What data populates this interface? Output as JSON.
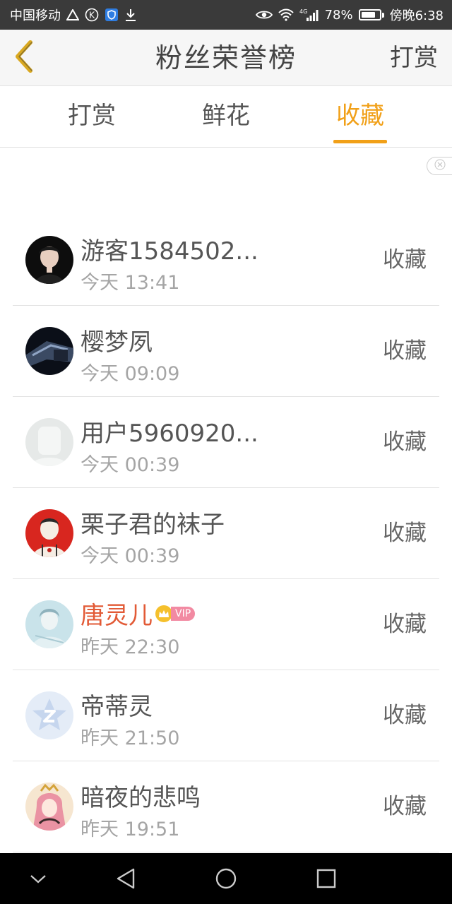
{
  "status_bar": {
    "carrier": "中国移动",
    "battery": "78%",
    "time": "傍晚6:38",
    "network": "4G",
    "icons": [
      "warning-icon",
      "k-icon",
      "shield-icon",
      "download-icon",
      "eye-icon",
      "wifi-icon",
      "signal-icon",
      "battery-icon"
    ]
  },
  "header": {
    "title": "粉丝荣誉榜",
    "action": "打赏",
    "back_icon": "chevron-left-icon"
  },
  "tabs": [
    {
      "label": "打赏",
      "active": false
    },
    {
      "label": "鲜花",
      "active": false
    },
    {
      "label": "收藏",
      "active": true
    }
  ],
  "colors": {
    "accent": "#f1a018",
    "vip_name": "#e25a36",
    "text_primary": "#555555",
    "text_secondary": "#a5a5a5"
  },
  "fans": [
    {
      "name": "游客1584502...",
      "time": "今天 13:41",
      "action": "收藏",
      "avatar": "avatar-photo-boy"
    },
    {
      "name": "樱梦夙",
      "time": "今天 09:09",
      "action": "收藏",
      "avatar": "avatar-photo-dark"
    },
    {
      "name": "用户5960920...",
      "time": "今天 00:39",
      "action": "收藏",
      "avatar": "avatar-default"
    },
    {
      "name": "栗子君的袜子",
      "time": "今天 00:39",
      "action": "收藏",
      "avatar": "avatar-illustration-red"
    },
    {
      "name": "唐灵儿",
      "time": "昨天 22:30",
      "action": "收藏",
      "avatar": "avatar-photo-blue",
      "vip": "VIP"
    },
    {
      "name": "帝蒂灵",
      "time": "昨天 21:50",
      "action": "收藏",
      "avatar": "avatar-qq-default"
    },
    {
      "name": "暗夜的悲鸣",
      "time": "昨天 19:51",
      "action": "收藏",
      "avatar": "avatar-illustration-pink"
    }
  ],
  "nav_bar": {
    "icons": [
      "chevron-down-icon",
      "back-triangle-icon",
      "home-circle-icon",
      "recents-square-icon"
    ]
  }
}
